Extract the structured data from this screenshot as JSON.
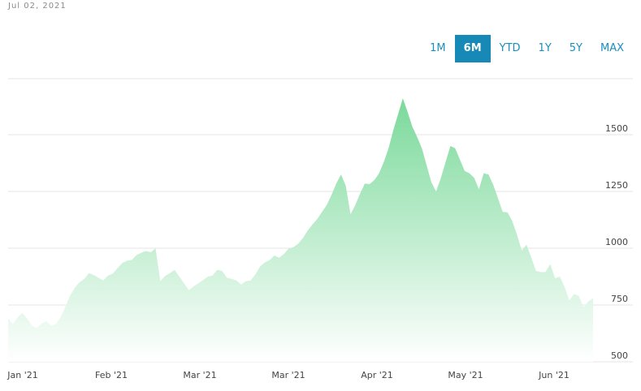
{
  "date_label": "Jul 02, 2021",
  "range_buttons": [
    "1M",
    "6M",
    "YTD",
    "1Y",
    "5Y",
    "MAX"
  ],
  "active_range": "6M",
  "colors": {
    "area_top": "#7ad99a",
    "area_bottom": "#ffffff",
    "grid": "#e6e6e6",
    "active_button": "#1689b7",
    "button_text": "#1a8fbf"
  },
  "chart_data": {
    "type": "area",
    "y_ticks": [
      500,
      750,
      1000,
      1250,
      1500
    ],
    "ylim": [
      500,
      1700
    ],
    "x_tick_labels": [
      "Jan '21",
      "Feb '21",
      "Mar '21",
      "Mar '21",
      "Apr '21",
      "May '21",
      "Jun '21"
    ],
    "grid": true,
    "series": [
      {
        "values": [
          690,
          665,
          695,
          715,
          690,
          660,
          648,
          668,
          678,
          660,
          665,
          695,
          740,
          790,
          825,
          850,
          865,
          890,
          882,
          870,
          858,
          880,
          888,
          912,
          935,
          945,
          948,
          970,
          980,
          988,
          982,
          1000,
          855,
          878,
          890,
          905,
          875,
          845,
          815,
          832,
          845,
          860,
          875,
          880,
          905,
          900,
          870,
          865,
          858,
          840,
          855,
          858,
          885,
          920,
          938,
          948,
          968,
          958,
          975,
          998,
          1005,
          1020,
          1045,
          1078,
          1105,
          1128,
          1160,
          1190,
          1235,
          1285,
          1325,
          1275,
          1150,
          1190,
          1240,
          1285,
          1282,
          1300,
          1330,
          1380,
          1440,
          1520,
          1590,
          1660,
          1600,
          1535,
          1490,
          1440,
          1365,
          1290,
          1250,
          1310,
          1380,
          1450,
          1440,
          1390,
          1340,
          1330,
          1310,
          1260,
          1330,
          1325,
          1280,
          1220,
          1160,
          1158,
          1120,
          1060,
          990,
          1015,
          960,
          900,
          895,
          895,
          930,
          868,
          875,
          830,
          770,
          798,
          790,
          740,
          765,
          780
        ]
      }
    ]
  }
}
